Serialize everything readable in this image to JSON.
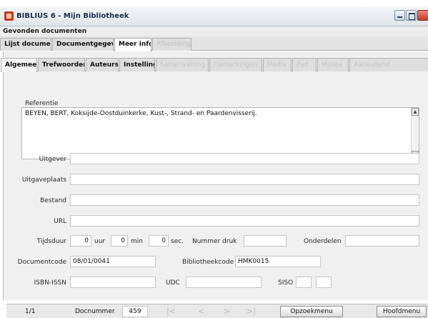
{
  "window": {
    "title": "BIBLIUS 6 - Mijn Bibliotheek"
  },
  "menu_label": "Gevonden documenten",
  "top_tabs": [
    {
      "label": "Lijst documenten",
      "state": "normal"
    },
    {
      "label": "Documentgegevens",
      "state": "normal"
    },
    {
      "label": "Meer info",
      "state": "active"
    },
    {
      "label": "Afbeelding",
      "state": "disabled"
    }
  ],
  "sub_tabs": [
    {
      "label": "Algemeen",
      "state": "active"
    },
    {
      "label": "Trefwoorden",
      "state": "normal"
    },
    {
      "label": "Auteurs",
      "state": "normal"
    },
    {
      "label": "Instelling",
      "state": "normal"
    },
    {
      "label": "Samenvatting",
      "state": "disabled"
    },
    {
      "label": "Opmerkingen",
      "state": "disabled"
    },
    {
      "label": "Media",
      "state": "disabled"
    },
    {
      "label": "Pad",
      "state": "disabled"
    },
    {
      "label": "Musea",
      "state": "disabled"
    },
    {
      "label": "Aanvullend",
      "state": "disabled"
    }
  ],
  "referentie": {
    "label": "Referentie",
    "value": "BEYEN, BERT, Koksijde-Oostduinkerke, Kust-, Strand- en Paardenvisserij."
  },
  "fields": {
    "uitgever": {
      "label": "Uitgever",
      "value": ""
    },
    "uitgaveplaats": {
      "label": "Uitgaveplaats",
      "value": ""
    },
    "bestand": {
      "label": "Bestand",
      "value": ""
    },
    "url": {
      "label": "URL",
      "value": ""
    }
  },
  "tijdsduur": {
    "label": "Tijdsduur",
    "uur_value": "0",
    "uur_unit": "uur",
    "min_value": "0",
    "min_unit": "min",
    "sec_value": "0",
    "sec_unit": "sec."
  },
  "nummer_druk": {
    "label": "Nummer druk",
    "value": ""
  },
  "onderdelen": {
    "label": "Onderdelen",
    "value": ""
  },
  "documentcode": {
    "label": "Documentcode",
    "value": "08/01/0041"
  },
  "bibliotheekcode": {
    "label": "Bibliotheekcode",
    "value": "HMK0015"
  },
  "isbn": {
    "label": "ISBN-ISSN",
    "value": ""
  },
  "udc": {
    "label": "UDC",
    "value": ""
  },
  "siso": {
    "label": "SISO",
    "value1": "",
    "value2": ""
  },
  "status": {
    "record_position": "1/1",
    "docnummer_label": "Docnummer",
    "docnummer_value": "459",
    "nav_first": "|<",
    "nav_prev": "<",
    "nav_next": ">",
    "nav_last": ">|",
    "opzoekmenu_label": "Opzoekmenu",
    "hoofdmenu_label": "Hoofdmenu"
  }
}
